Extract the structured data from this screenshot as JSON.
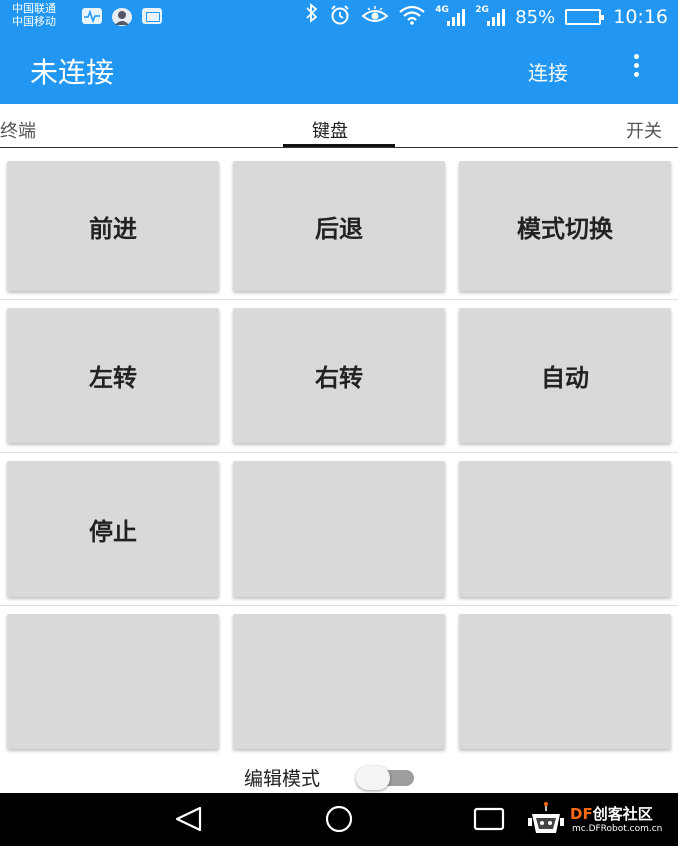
{
  "status_bar": {
    "carrier_1": "中国联通",
    "carrier_2": "中国移动",
    "net_1": "4G",
    "net_2": "2G",
    "battery": "85%",
    "battery_level": 0.85,
    "time": "10:16",
    "icons": [
      "heartbeat-icon",
      "avatar-icon",
      "image-icon",
      "bluetooth-icon",
      "alarm-icon",
      "eye-icon",
      "wifi-icon",
      "signal-icon",
      "signal-icon",
      "battery-icon"
    ]
  },
  "app_bar": {
    "title": "未连接",
    "connect_label": "连接",
    "overflow_icon": "more-vert-icon"
  },
  "tabs": [
    {
      "label": "终端"
    },
    {
      "label": "键盘"
    },
    {
      "label": "开关"
    }
  ],
  "active_tab": "键盘",
  "keys": [
    [
      "前进",
      "后退",
      "模式切换"
    ],
    [
      "左转",
      "右转",
      "自动"
    ],
    [
      "停止",
      "",
      ""
    ],
    [
      "",
      "",
      ""
    ]
  ],
  "edit_mode": {
    "label": "编辑模式",
    "enabled": false
  },
  "nav_bar": {
    "icons": [
      "back-icon",
      "home-icon",
      "recents-icon"
    ]
  },
  "watermark": {
    "brand_df": "DF",
    "brand_rest": "创客社区",
    "site": "mc.DFRobot.com.cn"
  },
  "colors": {
    "primary": "#2196f3",
    "key_bg": "#d9d9d9",
    "nav_bg": "#000000",
    "brand_orange": "#ff6a13"
  }
}
